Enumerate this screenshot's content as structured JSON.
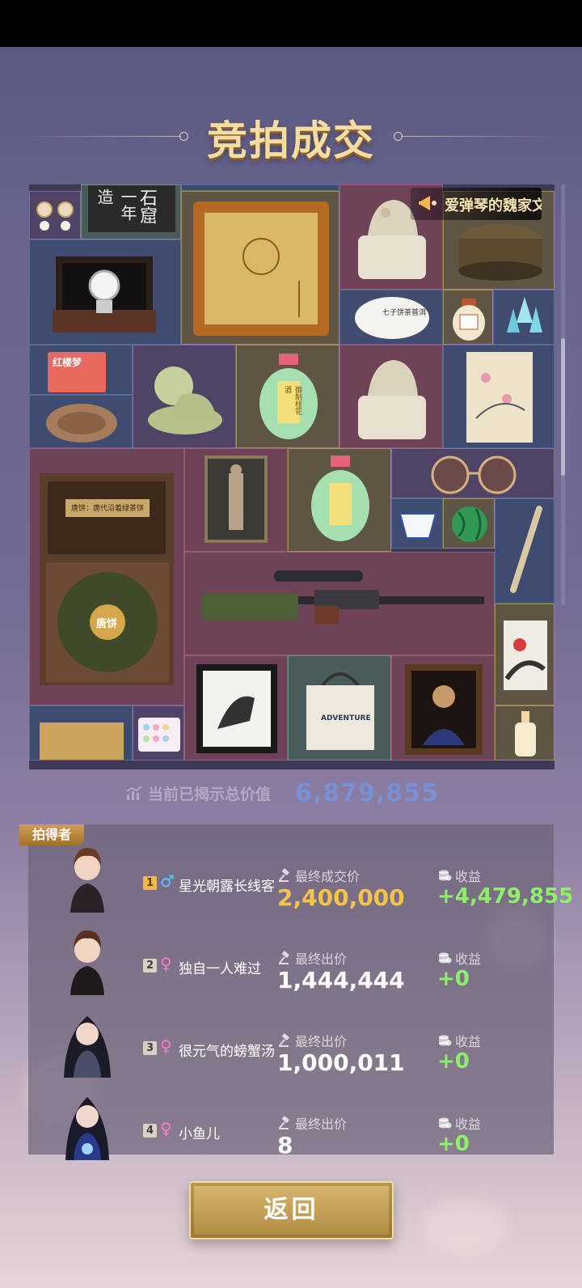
{
  "header": {
    "title": "竞拍成交"
  },
  "banner": {
    "text": "爱弹琴的魏家文"
  },
  "grid_labels": {
    "inscription_left": "一年造",
    "inscription_right": "石窟",
    "comic_box": "红楼梦",
    "tea_box_label": "唐饼：唐代沿着绿茶饼",
    "tea_cake": "唐饼",
    "wine_label": "御制桂花酒",
    "tote_label": "ADVENTURE",
    "tea_disc_label": "七子饼茶普洱"
  },
  "summary": {
    "label": "当前已揭示总价值",
    "value": "6,879,855"
  },
  "results": {
    "winner_tag": "拍得者",
    "rows": [
      {
        "rank": "1",
        "gender": "♂",
        "name": "星光朝露长线客",
        "price_label": "最终成交价",
        "price": "2,400,000",
        "gain_label": "收益",
        "gain": "+4,479,855"
      },
      {
        "rank": "2",
        "gender": "♀",
        "name": "独自一人难过",
        "price_label": "最终出价",
        "price": "1,444,444",
        "gain_label": "收益",
        "gain": "+0"
      },
      {
        "rank": "3",
        "gender": "♀",
        "name": "很元气的螃蟹汤",
        "price_label": "最终出价",
        "price": "1,000,011",
        "gain_label": "收益",
        "gain": "+0"
      },
      {
        "rank": "4",
        "gender": "♀",
        "name": "小鱼儿",
        "price_label": "最终出价",
        "price": "8",
        "gain_label": "收益",
        "gain": "+0"
      }
    ]
  },
  "actions": {
    "return_label": "返回"
  },
  "colors": {
    "accent_gold": "#f3c34a",
    "gain_green": "#8ef06a",
    "male_blue": "#5cc7ff",
    "female_pink": "#ff79c6"
  }
}
